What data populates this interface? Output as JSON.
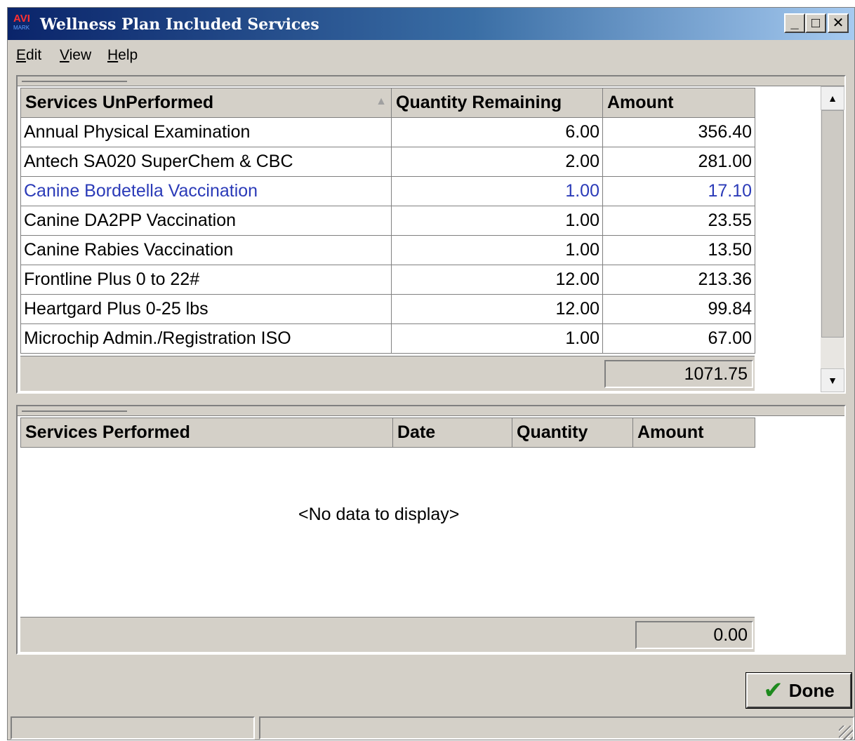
{
  "window": {
    "app_icon": "AVI",
    "app_icon_sub": "MARK",
    "title": "Wellness Plan Included Services",
    "controls": {
      "minimize": "_",
      "maximize": "□",
      "close": "✕"
    }
  },
  "menu": {
    "edit": {
      "accel": "E",
      "rest": "dit"
    },
    "view": {
      "accel": "V",
      "rest": "iew"
    },
    "help": {
      "accel": "H",
      "rest": "elp"
    }
  },
  "unperformed": {
    "columns": [
      "Services UnPerformed",
      "Quantity Remaining",
      "Amount"
    ],
    "sort_indicator": "▲",
    "rows": [
      {
        "service": "Annual Physical Examination",
        "quantity": "6.00",
        "amount": "356.40"
      },
      {
        "service": "Antech SA020 SuperChem & CBC",
        "quantity": "2.00",
        "amount": "281.00"
      },
      {
        "service": "Canine Bordetella Vaccination",
        "quantity": "1.00",
        "amount": "17.10"
      },
      {
        "service": "Canine DA2PP Vaccination",
        "quantity": "1.00",
        "amount": "23.55"
      },
      {
        "service": "Canine Rabies Vaccination",
        "quantity": "1.00",
        "amount": "13.50"
      },
      {
        "service": "Frontline Plus 0 to 22#",
        "quantity": "12.00",
        "amount": "213.36"
      },
      {
        "service": "Heartgard Plus 0-25 lbs",
        "quantity": "12.00",
        "amount": "99.84"
      },
      {
        "service": "Microchip Admin./Registration ISO",
        "quantity": "1.00",
        "amount": "67.00"
      }
    ],
    "selected_row": 2,
    "total": "1071.75",
    "scrollbar": {
      "up": "▲",
      "down": "▼"
    }
  },
  "performed": {
    "columns": [
      "Services Performed",
      "Date",
      "Quantity",
      "Amount"
    ],
    "empty_text": "<No data to display>",
    "total": "0.00"
  },
  "footer": {
    "done_label": "Done",
    "done_icon": "check-icon"
  },
  "colors": {
    "selected_text": "#2b3bb8",
    "title_gradient_start": "#0a246a",
    "title_gradient_end": "#a6caf0",
    "check": "#1e8a1e"
  }
}
